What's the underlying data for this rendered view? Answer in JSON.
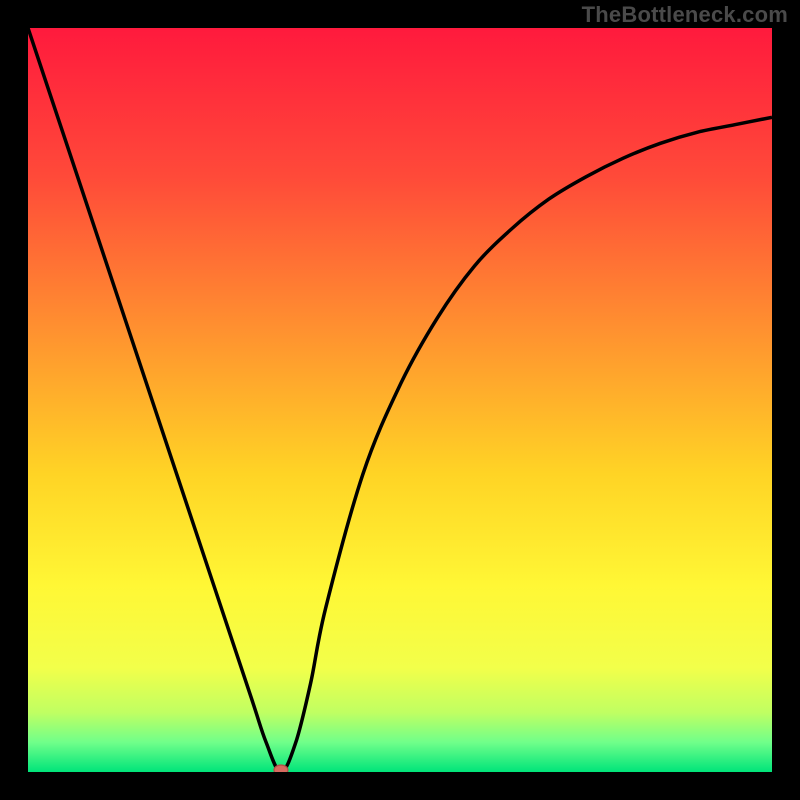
{
  "watermark": "TheBottleneck.com",
  "chart_data": {
    "type": "line",
    "title": "",
    "xlabel": "",
    "ylabel": "",
    "xlim": [
      0,
      100
    ],
    "ylim": [
      0,
      100
    ],
    "grid": false,
    "series": [
      {
        "name": "bottleneck-curve",
        "x": [
          0,
          5,
          10,
          15,
          20,
          25,
          30,
          32,
          34,
          36,
          38,
          40,
          45,
          50,
          55,
          60,
          65,
          70,
          75,
          80,
          85,
          90,
          95,
          100
        ],
        "y": [
          100,
          85,
          70,
          55,
          40,
          25,
          10,
          4,
          0,
          4,
          12,
          22,
          40,
          52,
          61,
          68,
          73,
          77,
          80,
          82.5,
          84.5,
          86,
          87,
          88
        ]
      }
    ],
    "marker": {
      "x": 34,
      "y": 0,
      "color": "#d66a5f"
    },
    "background_gradient": {
      "stops": [
        {
          "offset": 0.0,
          "color": "#ff1a3d"
        },
        {
          "offset": 0.2,
          "color": "#ff4a39"
        },
        {
          "offset": 0.4,
          "color": "#ff8f30"
        },
        {
          "offset": 0.6,
          "color": "#ffd425"
        },
        {
          "offset": 0.75,
          "color": "#fff735"
        },
        {
          "offset": 0.86,
          "color": "#f2ff4a"
        },
        {
          "offset": 0.92,
          "color": "#c0ff62"
        },
        {
          "offset": 0.96,
          "color": "#70ff8a"
        },
        {
          "offset": 1.0,
          "color": "#00e47a"
        }
      ]
    }
  }
}
